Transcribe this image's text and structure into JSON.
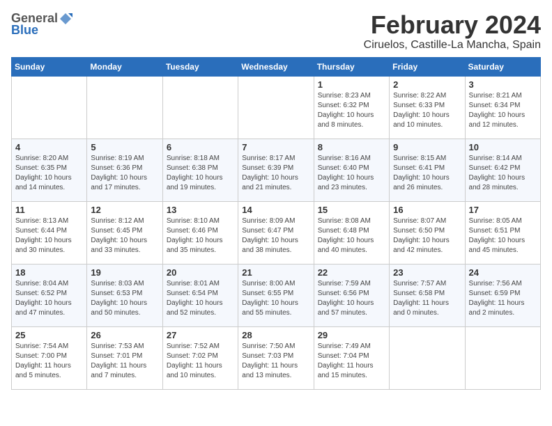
{
  "header": {
    "logo_general": "General",
    "logo_blue": "Blue",
    "month_title": "February 2024",
    "location": "Ciruelos, Castille-La Mancha, Spain"
  },
  "days_of_week": [
    "Sunday",
    "Monday",
    "Tuesday",
    "Wednesday",
    "Thursday",
    "Friday",
    "Saturday"
  ],
  "weeks": [
    [
      {
        "day": "",
        "info": ""
      },
      {
        "day": "",
        "info": ""
      },
      {
        "day": "",
        "info": ""
      },
      {
        "day": "",
        "info": ""
      },
      {
        "day": "1",
        "info": "Sunrise: 8:23 AM\nSunset: 6:32 PM\nDaylight: 10 hours\nand 8 minutes."
      },
      {
        "day": "2",
        "info": "Sunrise: 8:22 AM\nSunset: 6:33 PM\nDaylight: 10 hours\nand 10 minutes."
      },
      {
        "day": "3",
        "info": "Sunrise: 8:21 AM\nSunset: 6:34 PM\nDaylight: 10 hours\nand 12 minutes."
      }
    ],
    [
      {
        "day": "4",
        "info": "Sunrise: 8:20 AM\nSunset: 6:35 PM\nDaylight: 10 hours\nand 14 minutes."
      },
      {
        "day": "5",
        "info": "Sunrise: 8:19 AM\nSunset: 6:36 PM\nDaylight: 10 hours\nand 17 minutes."
      },
      {
        "day": "6",
        "info": "Sunrise: 8:18 AM\nSunset: 6:38 PM\nDaylight: 10 hours\nand 19 minutes."
      },
      {
        "day": "7",
        "info": "Sunrise: 8:17 AM\nSunset: 6:39 PM\nDaylight: 10 hours\nand 21 minutes."
      },
      {
        "day": "8",
        "info": "Sunrise: 8:16 AM\nSunset: 6:40 PM\nDaylight: 10 hours\nand 23 minutes."
      },
      {
        "day": "9",
        "info": "Sunrise: 8:15 AM\nSunset: 6:41 PM\nDaylight: 10 hours\nand 26 minutes."
      },
      {
        "day": "10",
        "info": "Sunrise: 8:14 AM\nSunset: 6:42 PM\nDaylight: 10 hours\nand 28 minutes."
      }
    ],
    [
      {
        "day": "11",
        "info": "Sunrise: 8:13 AM\nSunset: 6:44 PM\nDaylight: 10 hours\nand 30 minutes."
      },
      {
        "day": "12",
        "info": "Sunrise: 8:12 AM\nSunset: 6:45 PM\nDaylight: 10 hours\nand 33 minutes."
      },
      {
        "day": "13",
        "info": "Sunrise: 8:10 AM\nSunset: 6:46 PM\nDaylight: 10 hours\nand 35 minutes."
      },
      {
        "day": "14",
        "info": "Sunrise: 8:09 AM\nSunset: 6:47 PM\nDaylight: 10 hours\nand 38 minutes."
      },
      {
        "day": "15",
        "info": "Sunrise: 8:08 AM\nSunset: 6:48 PM\nDaylight: 10 hours\nand 40 minutes."
      },
      {
        "day": "16",
        "info": "Sunrise: 8:07 AM\nSunset: 6:50 PM\nDaylight: 10 hours\nand 42 minutes."
      },
      {
        "day": "17",
        "info": "Sunrise: 8:05 AM\nSunset: 6:51 PM\nDaylight: 10 hours\nand 45 minutes."
      }
    ],
    [
      {
        "day": "18",
        "info": "Sunrise: 8:04 AM\nSunset: 6:52 PM\nDaylight: 10 hours\nand 47 minutes."
      },
      {
        "day": "19",
        "info": "Sunrise: 8:03 AM\nSunset: 6:53 PM\nDaylight: 10 hours\nand 50 minutes."
      },
      {
        "day": "20",
        "info": "Sunrise: 8:01 AM\nSunset: 6:54 PM\nDaylight: 10 hours\nand 52 minutes."
      },
      {
        "day": "21",
        "info": "Sunrise: 8:00 AM\nSunset: 6:55 PM\nDaylight: 10 hours\nand 55 minutes."
      },
      {
        "day": "22",
        "info": "Sunrise: 7:59 AM\nSunset: 6:56 PM\nDaylight: 10 hours\nand 57 minutes."
      },
      {
        "day": "23",
        "info": "Sunrise: 7:57 AM\nSunset: 6:58 PM\nDaylight: 11 hours\nand 0 minutes."
      },
      {
        "day": "24",
        "info": "Sunrise: 7:56 AM\nSunset: 6:59 PM\nDaylight: 11 hours\nand 2 minutes."
      }
    ],
    [
      {
        "day": "25",
        "info": "Sunrise: 7:54 AM\nSunset: 7:00 PM\nDaylight: 11 hours\nand 5 minutes."
      },
      {
        "day": "26",
        "info": "Sunrise: 7:53 AM\nSunset: 7:01 PM\nDaylight: 11 hours\nand 7 minutes."
      },
      {
        "day": "27",
        "info": "Sunrise: 7:52 AM\nSunset: 7:02 PM\nDaylight: 11 hours\nand 10 minutes."
      },
      {
        "day": "28",
        "info": "Sunrise: 7:50 AM\nSunset: 7:03 PM\nDaylight: 11 hours\nand 13 minutes."
      },
      {
        "day": "29",
        "info": "Sunrise: 7:49 AM\nSunset: 7:04 PM\nDaylight: 11 hours\nand 15 minutes."
      },
      {
        "day": "",
        "info": ""
      },
      {
        "day": "",
        "info": ""
      }
    ]
  ]
}
